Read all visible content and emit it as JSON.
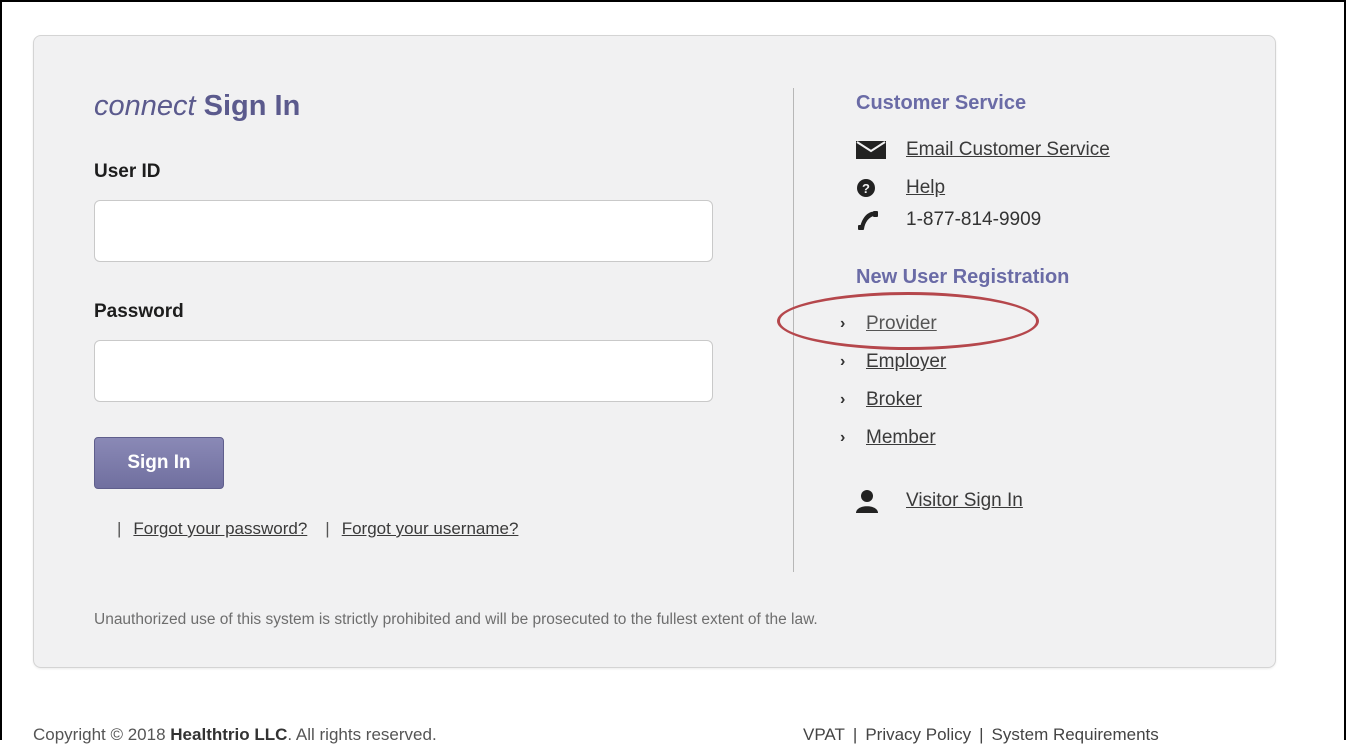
{
  "signin": {
    "title_brand": "connect",
    "title_rest": " Sign In",
    "userid_label": "User ID",
    "userid_value": "",
    "password_label": "Password",
    "password_value": "",
    "button_label": "Sign In",
    "sep": "|",
    "forgot_password": "Forgot your password?",
    "forgot_username": "Forgot your username?"
  },
  "customer_service": {
    "title": "Customer Service",
    "email": "Email Customer Service",
    "help": "Help",
    "phone": "1-877-814-9909"
  },
  "registration": {
    "title": "New User Registration",
    "items": [
      "Provider",
      "Employer",
      "Broker",
      "Member"
    ],
    "highlighted": "Provider"
  },
  "visitor": {
    "label": "Visitor Sign In"
  },
  "disclaimer": "Unauthorized use of this system is strictly prohibited and will be prosecuted to the fullest extent of the law.",
  "footer": {
    "copyright_prefix": "Copyright © 2018 ",
    "company": "Healthtrio LLC",
    "copyright_suffix": ". All rights reserved.",
    "links": [
      "VPAT",
      "Privacy Policy",
      "System Requirements"
    ],
    "sep": "|"
  },
  "colors": {
    "accent": "#5b5a8d",
    "section_title": "#6a6ba6",
    "button": "#7a79a8",
    "highlight": "#b5474c",
    "panel_bg": "#f1f1f2"
  }
}
